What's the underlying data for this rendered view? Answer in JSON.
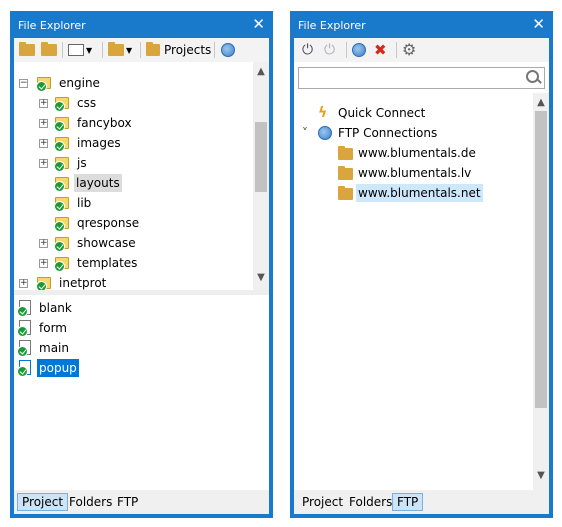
{
  "left": {
    "title": "File Explorer",
    "close": "✕",
    "toolbar": {
      "projects_label": "Projects"
    },
    "tree": [
      {
        "label": "engine",
        "expander": "−"
      },
      {
        "label": "css",
        "expander": "+"
      },
      {
        "label": "fancybox",
        "expander": "+"
      },
      {
        "label": "images",
        "expander": "+"
      },
      {
        "label": "js",
        "expander": "+"
      },
      {
        "label": "layouts",
        "expander": ""
      },
      {
        "label": "lib",
        "expander": ""
      },
      {
        "label": "qresponse",
        "expander": ""
      },
      {
        "label": "showcase",
        "expander": "+"
      },
      {
        "label": "templates",
        "expander": "+"
      },
      {
        "label": "inetprot",
        "expander": "+"
      }
    ],
    "files": [
      {
        "label": "blank"
      },
      {
        "label": "form"
      },
      {
        "label": "main"
      },
      {
        "label": "popup"
      }
    ],
    "tabs": [
      "Project",
      "Folders",
      "FTP"
    ]
  },
  "right": {
    "title": "File Explorer",
    "close": "✕",
    "search": {
      "value": "",
      "placeholder": ""
    },
    "tree": [
      {
        "label": "Quick Connect",
        "icon": "lightning-icon"
      },
      {
        "label": "FTP Connections",
        "icon": "globe-icon",
        "expander": "˅"
      },
      {
        "label": "www.blumentals.de",
        "icon": "ftp-folder-icon"
      },
      {
        "label": "www.blumentals.lv",
        "icon": "ftp-folder-icon"
      },
      {
        "label": "www.blumentals.net",
        "icon": "ftp-folder-icon"
      }
    ],
    "tabs": [
      "Project",
      "Folders",
      "FTP"
    ]
  },
  "colors": {
    "frame": "#1979ca",
    "selection": "#0078d7",
    "highlight": "#cde8fb",
    "tab_active": "#cde4f7"
  }
}
